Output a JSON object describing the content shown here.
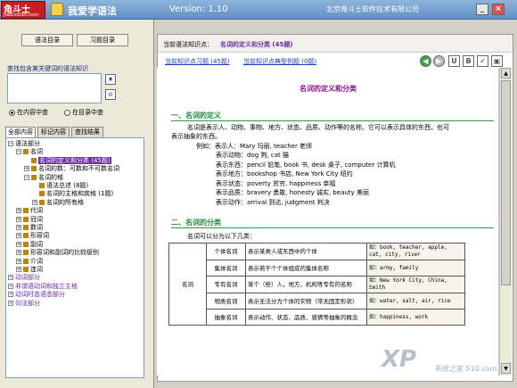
{
  "titlebar": {
    "logo_text": "角斗士",
    "logo_site": "JiaoDouShi.com",
    "app_name": "我爱学语法",
    "version": "Version: 1.10",
    "company": "北京角斗士软件技术有限公司",
    "minimize": "_",
    "close": "×"
  },
  "left": {
    "btn_grammar": "语法目录",
    "btn_exercise": "习题目录",
    "search_label": "查找包含某关键词的语法知识",
    "search_value": "",
    "search_btn": "♦",
    "clear_btn": "⊘",
    "radio_content": "在内容中查",
    "radio_toc": "在目录中查",
    "radio_selected": "content",
    "tabs": [
      "全部内容",
      "标记内容",
      "查找结果"
    ]
  },
  "tree": [
    {
      "label": "语法部分",
      "level": 0,
      "exp": "−",
      "book": false
    },
    {
      "label": "名词",
      "level": 1,
      "exp": "−",
      "book": true
    },
    {
      "label": "名词的定义和分类 (45题)",
      "level": 2,
      "exp": "",
      "book": true,
      "selected": true
    },
    {
      "label": "名词的数：可数和不可数名词",
      "level": 2,
      "exp": "+",
      "book": true
    },
    {
      "label": "名词的格",
      "level": 2,
      "exp": "−",
      "book": true
    },
    {
      "label": "语法总述 (8题)",
      "level": 3,
      "exp": "",
      "book": true
    },
    {
      "label": "名词的主格和宾格 (1题)",
      "level": 3,
      "exp": "",
      "book": true
    },
    {
      "label": "名词的所有格",
      "level": 3,
      "exp": "+",
      "book": true
    },
    {
      "label": "代词",
      "level": 1,
      "exp": "+",
      "book": true
    },
    {
      "label": "冠词",
      "level": 1,
      "exp": "+",
      "book": true
    },
    {
      "label": "数词",
      "level": 1,
      "exp": "+",
      "book": true
    },
    {
      "label": "形容词",
      "level": 1,
      "exp": "+",
      "book": true
    },
    {
      "label": "副词",
      "level": 1,
      "exp": "+",
      "book": true
    },
    {
      "label": "形容词和副词的比较级别",
      "level": 1,
      "exp": "+",
      "book": true
    },
    {
      "label": "介词",
      "level": 1,
      "exp": "+",
      "book": true
    },
    {
      "label": "连词",
      "level": 1,
      "exp": "+",
      "book": true
    },
    {
      "label": "动词部分",
      "level": 0,
      "exp": "+",
      "book": false,
      "purple": true
    },
    {
      "label": "非谓语动词和独立主格",
      "level": 0,
      "exp": "+",
      "book": false,
      "purple": true
    },
    {
      "label": "动词时态语态部分",
      "level": 0,
      "exp": "+",
      "book": false,
      "purple": true
    },
    {
      "label": "句法部分",
      "level": 0,
      "exp": "+",
      "book": false,
      "purple": true
    }
  ],
  "content": {
    "crumb_label": "当前语法知识点：",
    "crumb_value": "名词的定义和分类 (45题)",
    "link_exercises": "当前知识点习题 (45题)",
    "link_examples": "当前知识点典型例题 (0题)",
    "nav": {
      "back": "◀",
      "fwd": "▶",
      "u": "U",
      "b": "B",
      "mark": "✓",
      "print": "▣"
    },
    "doc_title": "名词的定义和分类",
    "sec1": "一、名词的定义",
    "def_line1": "名词是表示人、动物、事物、地方、状态、品质、动作等的名称。它可以表示具体的东西，也可",
    "def_line2": "表示抽象的东西。",
    "examples_intro": "例如：表示人：Mary 玛丽, teacher 老师",
    "examples": [
      "表示动物：dog 狗, cat 猫",
      "表示东西：pencil 铅笔, book 书, desk 桌子, computer 计算机",
      "表示地方：bookshop 书店, New York City 纽约",
      "表示状态：poverty 贫穷, happiness 幸福",
      "表示品质：bravery 勇敢, honesty 诚实, beauty 美丽",
      "表示动作：arrival 到达, judgment 判决"
    ],
    "sec2": "二、名词的分类",
    "class_intro": "名词可以分为以下几类：",
    "table_main": "名词",
    "table": [
      {
        "name": "个体名词",
        "desc": "表示某类人或东西中的个体",
        "ex": "如：book, teacher, apple, cat, city, river"
      },
      {
        "name": "集体名词",
        "desc": "表示若干个个体组成的集体名称",
        "ex": "如：army, family"
      },
      {
        "name": "专有名词",
        "desc": "某个（些）人，地方，机构等专有的名称",
        "ex": "如：New York City, China, Smith"
      },
      {
        "name": "物质名词",
        "desc": "表示无法分为个体的实物（常无固定形状）",
        "ex": "如：water, salt, air, rice"
      },
      {
        "name": "抽象名词",
        "desc": "表示动作、状态、品质、感情等抽象的概念",
        "ex": "如：happiness, work"
      }
    ]
  },
  "watermark": "XP",
  "watermark_sub": "系统之家 510.com"
}
